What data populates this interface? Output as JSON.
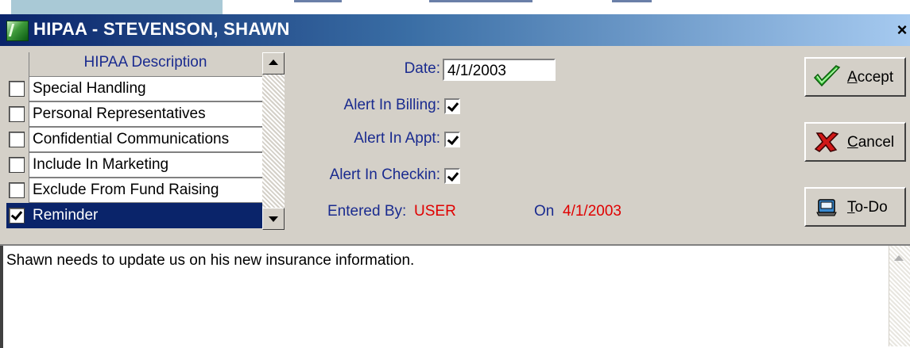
{
  "window": {
    "title": "HIPAA - STEVENSON, SHAWN",
    "close_glyph": "×"
  },
  "list": {
    "header": "HIPAA Description",
    "items": [
      {
        "label": "Special Handling",
        "checked": false,
        "selected": false
      },
      {
        "label": "Personal Representatives",
        "checked": false,
        "selected": false
      },
      {
        "label": "Confidential Communications",
        "checked": false,
        "selected": false
      },
      {
        "label": "Include In Marketing",
        "checked": false,
        "selected": false
      },
      {
        "label": "Exclude From Fund Raising",
        "checked": false,
        "selected": false
      },
      {
        "label": "Reminder",
        "checked": true,
        "selected": true
      }
    ]
  },
  "form": {
    "date_label": "Date:",
    "date_value": "4/1/2003",
    "alert_billing_label": "Alert In Billing:",
    "alert_billing_checked": true,
    "alert_appt_label": "Alert In Appt:",
    "alert_appt_checked": true,
    "alert_checkin_label": "Alert In Checkin:",
    "alert_checkin_checked": true,
    "entered_by_label": "Entered By:",
    "entered_by_value": "USER",
    "on_label": "On",
    "on_value": "4/1/2003"
  },
  "buttons": {
    "accept": {
      "hotkey": "A",
      "rest": "ccept",
      "icon": "checkmark-icon"
    },
    "cancel": {
      "hotkey": "C",
      "rest": "ancel",
      "icon": "x-icon"
    },
    "todo": {
      "hotkey": "T",
      "rest": "o-Do",
      "icon": "notepad-icon"
    }
  },
  "memo": {
    "text": "Shawn needs to update us on his new insurance information."
  },
  "colors": {
    "label_blue": "#1a2b8f",
    "value_red": "#e00000",
    "selection": "#0a246a"
  }
}
